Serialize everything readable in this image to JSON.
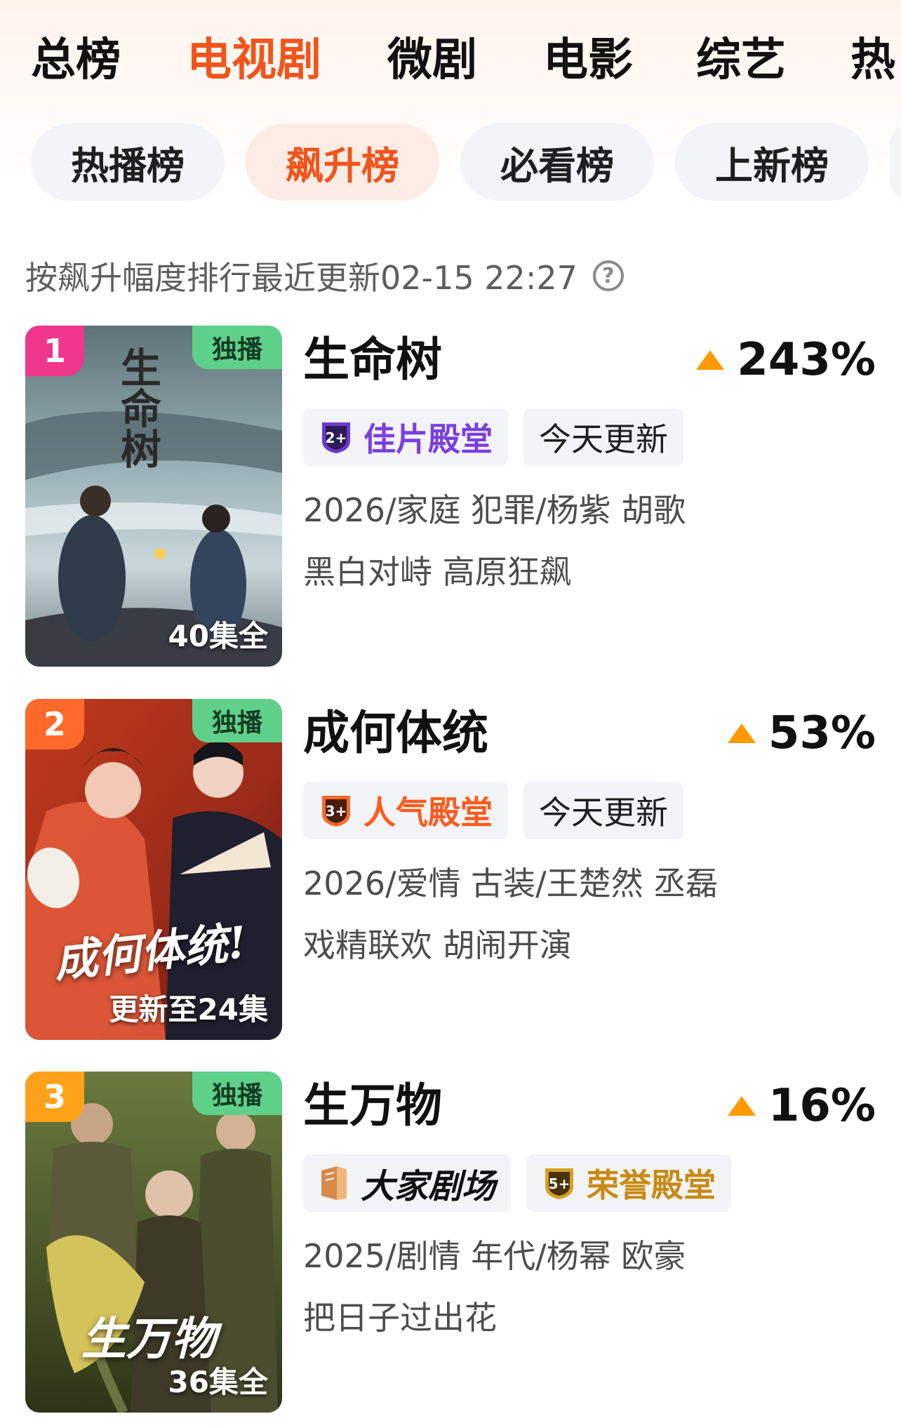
{
  "main_tabs": [
    "总榜",
    "电视剧",
    "微剧",
    "电影",
    "综艺",
    "热"
  ],
  "main_active": "电视剧",
  "sub_tabs": [
    "热播榜",
    "飙升榜",
    "必看榜",
    "上新榜"
  ],
  "sub_active": "飙升榜",
  "hint": {
    "text": "按飙升幅度排行最近更新02-15 22:27",
    "help_icon": "question-circle-icon"
  },
  "items": [
    {
      "rank": "1",
      "rank_color": "#f0368d",
      "exclusive_label": "独播",
      "poster_title": "生命树",
      "episode_label": "40集全",
      "title": "生命树",
      "change": "243%",
      "tags": [
        {
          "type": "hall",
          "icon": "hall-badge-icon",
          "icon_text": "2+",
          "label": "佳片殿堂",
          "color": "#7b3fe0"
        },
        {
          "type": "update",
          "label": "今天更新"
        }
      ],
      "meta": "2026/家庭 犯罪/杨紫 胡歌",
      "desc": "黑白对峙 高原狂飙"
    },
    {
      "rank": "2",
      "rank_color": "#ff6a2a",
      "exclusive_label": "独播",
      "poster_title": "成何体统!",
      "episode_label": "更新至24集",
      "title": "成何体统",
      "change": "53%",
      "tags": [
        {
          "type": "hall",
          "icon": "hall-badge-icon",
          "icon_text": "3+",
          "label": "人气殿堂",
          "color": "#ff5a1f"
        },
        {
          "type": "update",
          "label": "今天更新"
        }
      ],
      "meta": "2026/爱情 古装/王楚然 丞磊",
      "desc": "戏精联欢 胡闹开演"
    },
    {
      "rank": "3",
      "rank_color": "#ffa21a",
      "exclusive_label": "独播",
      "poster_title": "生万物",
      "episode_label": "36集全",
      "title": "生万物",
      "change": "16%",
      "tags": [
        {
          "type": "theater",
          "icon": "book-icon",
          "label": "大家剧场"
        },
        {
          "type": "hall",
          "icon": "hall-badge-icon",
          "icon_text": "5+",
          "label": "荣誉殿堂",
          "color": "#c88a12"
        }
      ],
      "meta": "2025/剧情 年代/杨幂 欧豪",
      "desc": "把日子过出花"
    }
  ]
}
